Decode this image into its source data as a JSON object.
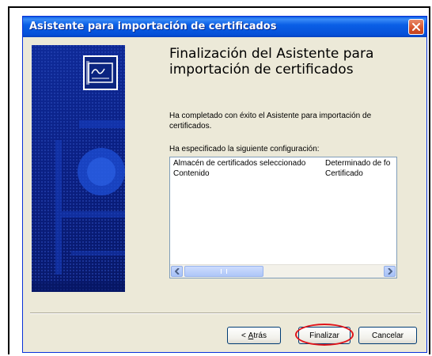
{
  "window": {
    "title": "Asistente para importación de certificados",
    "close_icon": "close-x"
  },
  "panel": {
    "icon": "certificate-icon",
    "accent": "#0a1f82"
  },
  "content": {
    "heading": "Finalización del Asistente para importación de certificados",
    "completed_text": "Ha completado con éxito el Asistente para importación de certificados.",
    "config_label": "Ha especificado la siguiente configuración:"
  },
  "listbox": {
    "rows": [
      {
        "setting": "Almacén de certificados seleccionado",
        "value": "Determinado de fo"
      },
      {
        "setting": "Contenido",
        "value": "Certificado"
      }
    ]
  },
  "buttons": {
    "back_prefix": "< ",
    "back_mnemonic": "A",
    "back_rest": "trás",
    "finish": "Finalizar",
    "cancel": "Cancelar"
  },
  "highlight_color": "#e0141a"
}
